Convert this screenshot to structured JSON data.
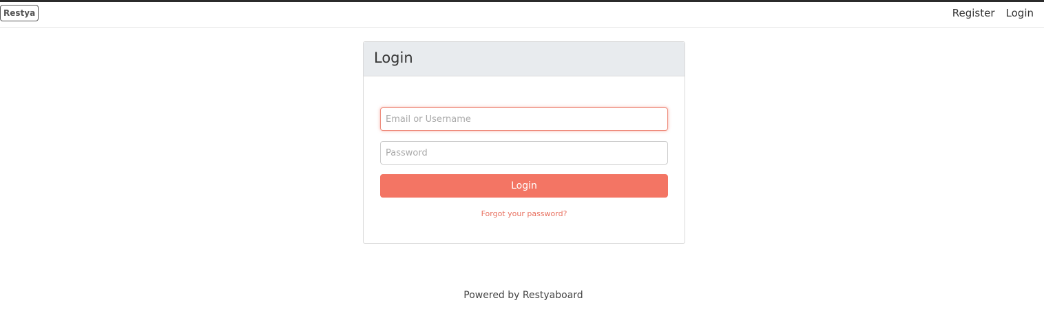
{
  "header": {
    "logo_text": "Restya",
    "nav": {
      "register": "Register",
      "login": "Login"
    }
  },
  "login_panel": {
    "title": "Login",
    "email_placeholder": "Email or Username",
    "password_placeholder": "Password",
    "submit_label": "Login",
    "forgot_link": "Forgot your password?"
  },
  "footer": {
    "text": "Powered by Restyaboard"
  },
  "colors": {
    "accent": "#f37564",
    "link": "#e8705f",
    "panel_header_bg": "#e8ebee"
  }
}
